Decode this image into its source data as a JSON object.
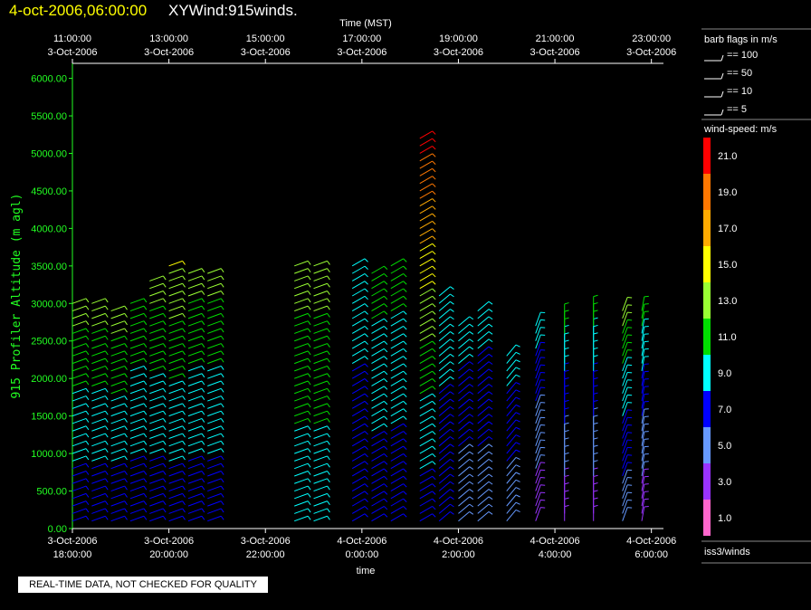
{
  "header": {
    "date": "4-oct-2006,06:00:00",
    "name": "XYWind:915winds."
  },
  "notice": "REAL-TIME DATA, NOT CHECKED FOR QUALITY",
  "chart_data": {
    "type": "scatter",
    "ylabel": "915 Profiler Altitude (m agl)",
    "xlabel_bottom": "time",
    "xlabel_top": "Time (MST)",
    "ylim": [
      0,
      6200
    ],
    "yticks": [
      "0.00",
      "500.00",
      "1000.00",
      "1500.00",
      "2000.00",
      "2500.00",
      "3000.00",
      "3500.00",
      "4000.00",
      "4500.00",
      "5000.00",
      "5500.00",
      "6000.00"
    ],
    "bottom_ticks": [
      {
        "date": "3-Oct-2006",
        "time": "18:00:00"
      },
      {
        "date": "3-Oct-2006",
        "time": "20:00:00"
      },
      {
        "date": "3-Oct-2006",
        "time": "22:00:00"
      },
      {
        "date": "4-Oct-2006",
        "time": "0:00:00"
      },
      {
        "date": "4-Oct-2006",
        "time": "2:00:00"
      },
      {
        "date": "4-Oct-2006",
        "time": "4:00:00"
      },
      {
        "date": "4-Oct-2006",
        "time": "6:00:00"
      }
    ],
    "top_ticks": [
      {
        "time": "11:00:00",
        "date": "3-Oct-2006"
      },
      {
        "time": "13:00:00",
        "date": "3-Oct-2006"
      },
      {
        "time": "15:00:00",
        "date": "3-Oct-2006"
      },
      {
        "time": "17:00:00",
        "date": "3-Oct-2006"
      },
      {
        "time": "19:00:00",
        "date": "3-Oct-2006"
      },
      {
        "time": "21:00:00",
        "date": "3-Oct-2006"
      },
      {
        "time": "23:00:00",
        "date": "3-Oct-2006"
      }
    ],
    "barb_legend": {
      "title": "barb flags in m/s",
      "items": [
        "== 100",
        "== 50",
        "== 10",
        "== 5"
      ]
    },
    "speed_legend": {
      "title": "wind-speed: m/s",
      "levels": [
        {
          "label": "21.0",
          "color": "#ff0000"
        },
        {
          "label": "19.0",
          "color": "#ff7700"
        },
        {
          "label": "17.0",
          "color": "#ffaa00"
        },
        {
          "label": "15.0",
          "color": "#ffff00"
        },
        {
          "label": "13.0",
          "color": "#99ff33"
        },
        {
          "label": "11.0",
          "color": "#00dd00"
        },
        {
          "label": "9.0",
          "color": "#00ffff"
        },
        {
          "label": "7.0",
          "color": "#0000ff"
        },
        {
          "label": "5.0",
          "color": "#6699ff"
        },
        {
          "label": "3.0",
          "color": "#9933ff"
        },
        {
          "label": "1.0",
          "color": "#ff66cc"
        }
      ]
    },
    "source": "iss3/winds",
    "colors": {
      "axis": "#22ff22",
      "frame": "#ffffff"
    },
    "profiles": [
      {
        "hour": -6.0,
        "top": 3050,
        "speed_low": 7,
        "speed_high": 13,
        "dir": 250
      },
      {
        "hour": -5.6,
        "top": 3000,
        "speed_low": 7,
        "speed_high": 13,
        "dir": 250
      },
      {
        "hour": -5.2,
        "top": 2950,
        "speed_low": 7,
        "speed_high": 13,
        "dir": 250
      },
      {
        "hour": -4.8,
        "top": 3050,
        "speed_low": 7,
        "speed_high": 12,
        "dir": 250
      },
      {
        "hour": -4.4,
        "top": 3350,
        "speed_low": 7,
        "speed_high": 13,
        "dir": 250
      },
      {
        "hour": -4.0,
        "top": 3500,
        "speed_low": 7,
        "speed_high": 14,
        "dir": 250
      },
      {
        "hour": -3.6,
        "top": 3450,
        "speed_low": 7,
        "speed_high": 13,
        "dir": 250
      },
      {
        "hour": -3.2,
        "top": 3450,
        "speed_low": 7,
        "speed_high": 13,
        "dir": 250
      },
      {
        "hour": -1.4,
        "top": 3550,
        "speed_low": 9,
        "speed_high": 13,
        "dir": 250
      },
      {
        "hour": -1.0,
        "top": 3550,
        "speed_low": 9,
        "speed_high": 13,
        "dir": 250
      },
      {
        "hour": -0.2,
        "top": 3500,
        "speed_low": 7,
        "speed_high": 9,
        "dir": 240
      },
      {
        "hour": 0.2,
        "top": 3400,
        "speed_low": 7,
        "speed_high": 11,
        "dir": 240
      },
      {
        "hour": 0.6,
        "top": 3500,
        "speed_low": 7,
        "speed_high": 11,
        "dir": 240
      },
      {
        "hour": 1.2,
        "top": 5200,
        "speed_low": 7,
        "speed_high": 21,
        "dir": 240
      },
      {
        "hour": 1.6,
        "top": 3100,
        "speed_low": 7,
        "speed_high": 9,
        "dir": 230
      },
      {
        "hour": 2.0,
        "top": 2700,
        "speed_low": 5,
        "speed_high": 9,
        "dir": 230
      },
      {
        "hour": 2.4,
        "top": 2900,
        "speed_low": 5,
        "speed_high": 9,
        "dir": 230
      },
      {
        "hour": 3.0,
        "top": 2300,
        "speed_low": 5,
        "speed_high": 9,
        "dir": 220
      },
      {
        "hour": 3.6,
        "top": 2700,
        "speed_low": 3,
        "speed_high": 9,
        "dir": 200
      },
      {
        "hour": 4.2,
        "top": 2800,
        "speed_low": 3,
        "speed_high": 11,
        "dir": 180
      },
      {
        "hour": 4.8,
        "top": 2900,
        "speed_low": 3,
        "speed_high": 11,
        "dir": 180
      },
      {
        "hour": 5.4,
        "top": 2950,
        "speed_low": 5,
        "speed_high": 13,
        "dir": 200
      },
      {
        "hour": 5.8,
        "top": 2900,
        "speed_low": 3,
        "speed_high": 11,
        "dir": 190
      }
    ]
  }
}
